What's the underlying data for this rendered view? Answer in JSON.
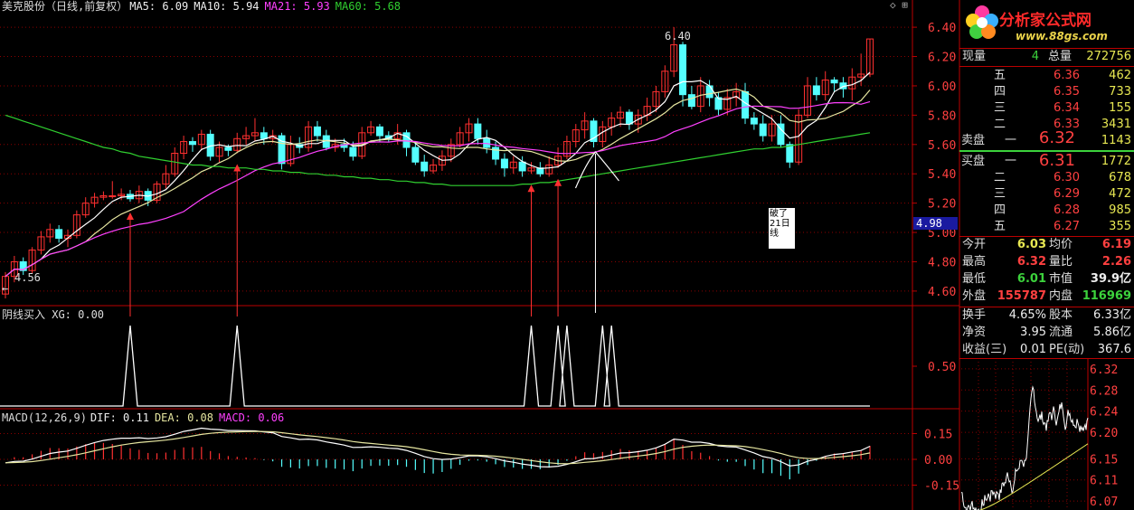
{
  "header": {
    "title": "美克股份（日线,前复权）",
    "ma5": "MA5: 6.09",
    "ma10": "MA10: 5.94",
    "ma21": "MA21: 5.93",
    "ma60": "MA60: 5.68",
    "top_right_glyph": "◇ ⊞"
  },
  "indicator": {
    "label": "阴线买入 XG: 0.00"
  },
  "macd": {
    "label_params": "MACD(12,26,9)",
    "dif": "DIF: 0.11",
    "dea": "DEA: 0.08",
    "macd": "MACD: 0.06"
  },
  "annotations": {
    "high_label": "6.40",
    "low_label": "4.56",
    "note_text": "破了21日线",
    "price_box": "4.98",
    "left_arrow": "←"
  },
  "colors": {
    "up": "#ff3030",
    "down": "#54ffff",
    "ma5": "#ffffff",
    "ma10": "#e6e6a0",
    "ma21": "#ff40ff",
    "ma60": "#30d030",
    "grid": "#8b0000"
  },
  "logo": {
    "title": "分析家公式网",
    "url": "www.88gs.com"
  },
  "quote": {
    "volume_now_label": "现量",
    "volume_now": "4",
    "total_volume_label": "总量",
    "total_volume": "272756",
    "sell": [
      {
        "label": "五",
        "price": "6.36",
        "vol": "462"
      },
      {
        "label": "四",
        "price": "6.35",
        "vol": "733"
      },
      {
        "label": "三",
        "price": "6.34",
        "vol": "155"
      },
      {
        "label": "二",
        "price": "6.33",
        "vol": "3431"
      },
      {
        "label": "一",
        "price": "6.32",
        "vol": "1143"
      }
    ],
    "sell_title": "卖盘",
    "buy_title": "买盘",
    "buy": [
      {
        "label": "一",
        "price": "6.31",
        "vol": "1772"
      },
      {
        "label": "二",
        "price": "6.30",
        "vol": "678"
      },
      {
        "label": "三",
        "price": "6.29",
        "vol": "472"
      },
      {
        "label": "四",
        "price": "6.28",
        "vol": "985"
      },
      {
        "label": "五",
        "price": "6.27",
        "vol": "355"
      }
    ],
    "stats": [
      {
        "l1": "今开",
        "v1": "6.03",
        "c1": "yel",
        "l2": "均价",
        "v2": "6.19",
        "c2": "red"
      },
      {
        "l1": "最高",
        "v1": "6.32",
        "c1": "red",
        "l2": "量比",
        "v2": "2.26",
        "c2": "red"
      },
      {
        "l1": "最低",
        "v1": "6.01",
        "c1": "grn",
        "l2": "市值",
        "v2": "39.9亿",
        "c2": "wht"
      },
      {
        "l1": "外盘",
        "v1": "155787",
        "c1": "red",
        "l2": "内盘",
        "v2": "116969",
        "c2": "grn"
      }
    ],
    "stats2": [
      {
        "l1": "换手",
        "v1": "4.65%",
        "l2": "股本",
        "v2": "6.33亿"
      },
      {
        "l1": "净资",
        "v1": "3.95",
        "l2": "流通",
        "v2": "5.86亿"
      },
      {
        "l1": "收益(三)",
        "v1": "0.01",
        "l2": "PE(动)",
        "v2": "367.6"
      }
    ]
  },
  "axes": {
    "price_ticks": [
      "6.40",
      "6.20",
      "6.00",
      "5.80",
      "5.60",
      "5.40",
      "5.20",
      "5.00",
      "4.80",
      "4.60"
    ],
    "indicator_ticks": [
      "0.50"
    ],
    "macd_ticks": [
      "0.15",
      "0.00",
      "-0.15"
    ],
    "mini_ticks": [
      "6.32",
      "6.28",
      "6.24",
      "6.20",
      "6.15",
      "6.11",
      "6.07"
    ]
  },
  "chart_data": {
    "type": "candlestick",
    "price_range": [
      4.55,
      6.45
    ],
    "candles": [
      [
        4.58,
        4.7,
        4.55,
        4.73
      ],
      [
        4.7,
        4.8,
        4.66,
        4.84
      ],
      [
        4.8,
        4.74,
        4.71,
        4.83
      ],
      [
        4.74,
        4.88,
        4.72,
        4.9
      ],
      [
        4.88,
        4.97,
        4.85,
        5.01
      ],
      [
        4.97,
        5.02,
        4.93,
        5.06
      ],
      [
        5.02,
        4.96,
        4.93,
        5.05
      ],
      [
        4.96,
        4.98,
        4.9,
        5.02
      ],
      [
        4.98,
        5.12,
        4.96,
        5.15
      ],
      [
        5.12,
        5.2,
        5.1,
        5.24
      ],
      [
        5.2,
        5.24,
        5.17,
        5.27
      ],
      [
        5.24,
        5.25,
        5.22,
        5.28
      ],
      [
        5.25,
        5.25,
        5.23,
        5.35
      ],
      [
        5.25,
        5.26,
        5.22,
        5.3
      ],
      [
        5.26,
        5.23,
        5.21,
        5.29
      ],
      [
        5.23,
        5.28,
        5.2,
        5.32
      ],
      [
        5.28,
        5.22,
        5.18,
        5.3
      ],
      [
        5.22,
        5.33,
        5.2,
        5.35
      ],
      [
        5.33,
        5.4,
        5.3,
        5.46
      ],
      [
        5.4,
        5.54,
        5.38,
        5.58
      ],
      [
        5.54,
        5.62,
        5.5,
        5.66
      ],
      [
        5.62,
        5.6,
        5.55,
        5.65
      ],
      [
        5.6,
        5.67,
        5.56,
        5.7
      ],
      [
        5.67,
        5.52,
        5.49,
        5.7
      ],
      [
        5.52,
        5.58,
        5.48,
        5.62
      ],
      [
        5.58,
        5.56,
        5.52,
        5.6
      ],
      [
        5.56,
        5.64,
        5.54,
        5.68
      ],
      [
        5.64,
        5.66,
        5.6,
        5.72
      ],
      [
        5.66,
        5.68,
        5.62,
        5.78
      ],
      [
        5.68,
        5.64,
        5.6,
        5.72
      ],
      [
        5.64,
        5.66,
        5.61,
        5.7
      ],
      [
        5.66,
        5.47,
        5.43,
        5.68
      ],
      [
        5.47,
        5.6,
        5.45,
        5.66
      ],
      [
        5.6,
        5.58,
        5.54,
        5.65
      ],
      [
        5.58,
        5.72,
        5.55,
        5.76
      ],
      [
        5.72,
        5.66,
        5.62,
        5.76
      ],
      [
        5.66,
        5.58,
        5.56,
        5.7
      ],
      [
        5.58,
        5.6,
        5.55,
        5.64
      ],
      [
        5.6,
        5.58,
        5.55,
        5.64
      ],
      [
        5.58,
        5.52,
        5.49,
        5.62
      ],
      [
        5.52,
        5.68,
        5.5,
        5.72
      ],
      [
        5.68,
        5.72,
        5.66,
        5.76
      ],
      [
        5.72,
        5.66,
        5.62,
        5.74
      ],
      [
        5.66,
        5.64,
        5.62,
        5.69
      ],
      [
        5.64,
        5.68,
        5.6,
        5.74
      ],
      [
        5.68,
        5.58,
        5.52,
        5.7
      ],
      [
        5.58,
        5.48,
        5.46,
        5.62
      ],
      [
        5.48,
        5.42,
        5.38,
        5.53
      ],
      [
        5.42,
        5.46,
        5.4,
        5.5
      ],
      [
        5.46,
        5.52,
        5.42,
        5.56
      ],
      [
        5.52,
        5.6,
        5.48,
        5.64
      ],
      [
        5.6,
        5.68,
        5.58,
        5.72
      ],
      [
        5.68,
        5.74,
        5.62,
        5.78
      ],
      [
        5.74,
        5.64,
        5.6,
        5.78
      ],
      [
        5.64,
        5.58,
        5.54,
        5.7
      ],
      [
        5.58,
        5.5,
        5.46,
        5.62
      ],
      [
        5.5,
        5.44,
        5.38,
        5.54
      ],
      [
        5.44,
        5.48,
        5.4,
        5.52
      ],
      [
        5.48,
        5.42,
        5.38,
        5.52
      ],
      [
        5.42,
        5.44,
        5.4,
        5.48
      ],
      [
        5.44,
        5.4,
        5.38,
        5.48
      ],
      [
        5.4,
        5.46,
        5.38,
        5.52
      ],
      [
        5.46,
        5.52,
        5.44,
        5.58
      ],
      [
        5.52,
        5.62,
        5.5,
        5.66
      ],
      [
        5.62,
        5.7,
        5.58,
        5.74
      ],
      [
        5.7,
        5.76,
        5.64,
        5.82
      ],
      [
        5.76,
        5.62,
        5.58,
        5.78
      ],
      [
        5.62,
        5.72,
        5.58,
        5.76
      ],
      [
        5.72,
        5.78,
        5.66,
        5.82
      ],
      [
        5.78,
        5.82,
        5.72,
        5.86
      ],
      [
        5.82,
        5.74,
        5.7,
        5.84
      ],
      [
        5.74,
        5.8,
        5.68,
        5.84
      ],
      [
        5.8,
        5.86,
        5.76,
        5.92
      ],
      [
        5.86,
        5.96,
        5.82,
        6.0
      ],
      [
        5.96,
        6.1,
        5.92,
        6.14
      ],
      [
        6.1,
        6.28,
        6.06,
        6.4
      ],
      [
        6.28,
        5.94,
        5.86,
        6.3
      ],
      [
        5.94,
        5.86,
        5.84,
        6.0
      ],
      [
        5.86,
        6.0,
        5.82,
        6.06
      ],
      [
        6.0,
        5.92,
        5.86,
        6.04
      ],
      [
        5.92,
        5.84,
        5.8,
        5.96
      ],
      [
        5.84,
        5.92,
        5.8,
        5.98
      ],
      [
        5.92,
        5.96,
        5.86,
        6.02
      ],
      [
        5.96,
        5.78,
        5.74,
        6.02
      ],
      [
        5.78,
        5.74,
        5.7,
        5.82
      ],
      [
        5.74,
        5.66,
        5.62,
        5.8
      ],
      [
        5.66,
        5.74,
        5.62,
        5.8
      ],
      [
        5.74,
        5.6,
        5.58,
        5.8
      ],
      [
        5.6,
        5.48,
        5.44,
        5.62
      ],
      [
        5.48,
        5.8,
        5.46,
        5.84
      ],
      [
        5.8,
        6.0,
        5.78,
        6.06
      ],
      [
        6.0,
        5.94,
        5.9,
        6.06
      ],
      [
        5.94,
        6.04,
        5.9,
        6.1
      ],
      [
        6.04,
        6.02,
        5.96,
        6.06
      ],
      [
        6.02,
        5.98,
        5.92,
        6.06
      ],
      [
        5.98,
        6.06,
        5.9,
        6.12
      ],
      [
        6.06,
        6.08,
        6.0,
        6.22
      ],
      [
        6.08,
        6.32,
        6.06,
        6.32
      ]
    ],
    "ma60": [
      5.8,
      5.78,
      5.76,
      5.74,
      5.72,
      5.7,
      5.68,
      5.66,
      5.64,
      5.62,
      5.6,
      5.58,
      5.57,
      5.55,
      5.54,
      5.52,
      5.51,
      5.5,
      5.49,
      5.48,
      5.47,
      5.46,
      5.46,
      5.45,
      5.45,
      5.44,
      5.44,
      5.44,
      5.43,
      5.43,
      5.42,
      5.42,
      5.41,
      5.41,
      5.4,
      5.4,
      5.39,
      5.39,
      5.38,
      5.38,
      5.37,
      5.37,
      5.36,
      5.36,
      5.35,
      5.35,
      5.34,
      5.34,
      5.33,
      5.33,
      5.32,
      5.32,
      5.32,
      5.32,
      5.32,
      5.32,
      5.32,
      5.32,
      5.33,
      5.33,
      5.34,
      5.34,
      5.35,
      5.36,
      5.37,
      5.38,
      5.39,
      5.4,
      5.41,
      5.42,
      5.43,
      5.44,
      5.45,
      5.46,
      5.47,
      5.48,
      5.49,
      5.5,
      5.51,
      5.52,
      5.53,
      5.54,
      5.55,
      5.56,
      5.57,
      5.57,
      5.58,
      5.58,
      5.59,
      5.6,
      5.61,
      5.62,
      5.63,
      5.64,
      5.65,
      5.66,
      5.67,
      5.68
    ],
    "signals": [
      14,
      26,
      59,
      62,
      63,
      67,
      68
    ],
    "arrows_red": [
      14,
      26,
      59,
      62
    ],
    "arrow_white": 66
  }
}
